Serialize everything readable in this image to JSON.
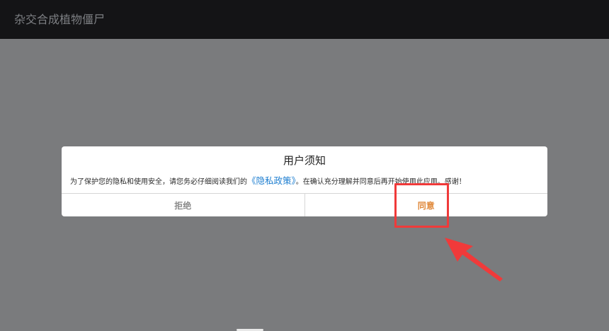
{
  "app": {
    "title": "杂交合成植物僵尸"
  },
  "dialog": {
    "title": "用户须知",
    "body_prefix": "为了保护您的隐私和使用安全，请您务必仔细阅读我们的",
    "policy_link": "《隐私政策》",
    "body_suffix": "。在确认充分理解并同意后再开始使用此应用。感谢！",
    "reject_label": "拒绝",
    "agree_label": "同意"
  },
  "colors": {
    "overlay": "#7a7b7d",
    "titlebar": "#141416",
    "link": "#1f7fd0",
    "agree": "#e08a3c",
    "reject": "#8c8c8c",
    "annotation": "#f03a3a"
  }
}
